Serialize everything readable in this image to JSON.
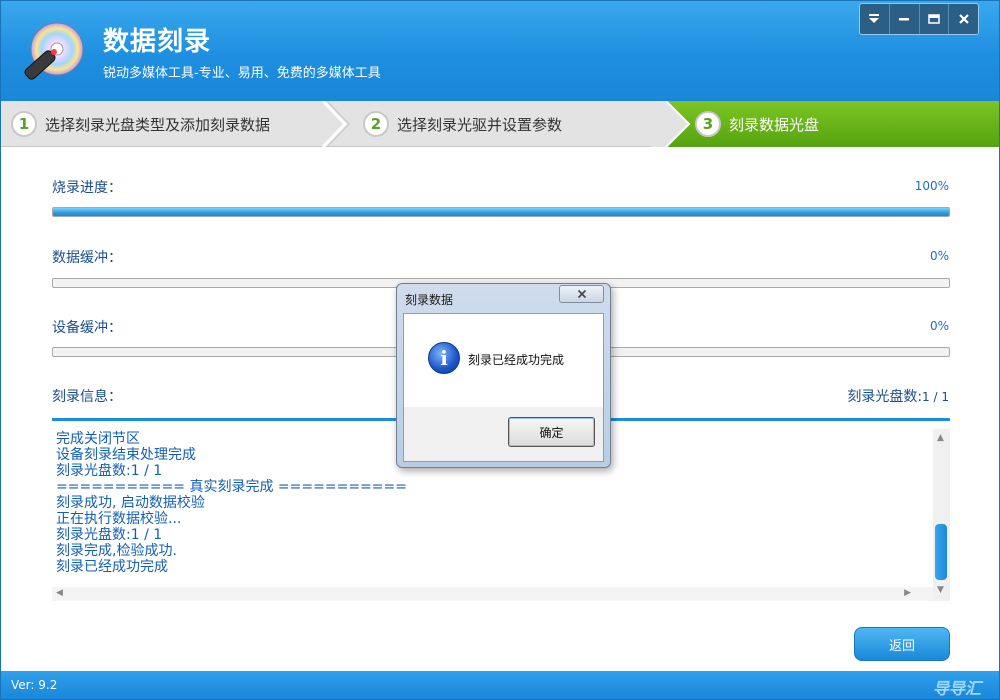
{
  "app": {
    "title": "数据刻录",
    "subtitle": "锐动多媒体工具-专业、易用、免费的多媒体工具"
  },
  "window_controls": {
    "menu_icon": "menu-icon",
    "minimize_icon": "minimize-icon",
    "maximize_icon": "maximize-icon",
    "close_icon": "close-icon"
  },
  "steps": [
    {
      "number": "1",
      "label": "选择刻录光盘类型及添加刻录数据",
      "active": false
    },
    {
      "number": "2",
      "label": "选择刻录光驱并设置参数",
      "active": false
    },
    {
      "number": "3",
      "label": "刻录数据光盘",
      "active": true
    }
  ],
  "progress": {
    "burn": {
      "label": "烧录进度：",
      "percent_text": "100%",
      "value": 100
    },
    "data_buffer": {
      "label": "数据缓冲：",
      "percent_text": "0%",
      "value": 0
    },
    "device_buffer": {
      "label": "设备缓冲：",
      "percent_text": "0%",
      "value": 0
    }
  },
  "info": {
    "label": "刻录信息：",
    "disc_count_label": "刻录光盘数:",
    "disc_count_value": "1 / 1"
  },
  "log_lines": [
    "完成关闭节区",
    "设备刻录结束处理完成",
    "刻录光盘数:1 / 1",
    "=========== 真实刻录完成 ===========",
    "刻录成功, 启动数据校验",
    "正在执行数据校验...",
    "刻录光盘数:1 / 1",
    "刻录完成,检验成功.",
    "刻录已经成功完成"
  ],
  "back_button": "返回",
  "footer": {
    "version": "Ver: 9.2",
    "watermark": "导导汇"
  },
  "dialog": {
    "title": "刻录数据",
    "message": "刻录已经成功完成",
    "ok_button": "确定"
  },
  "colors": {
    "header_blue": "#1e8fe0",
    "active_step_green": "#55a30f",
    "progress_blue": "#2a9be3",
    "log_text_blue": "#1260b5"
  }
}
